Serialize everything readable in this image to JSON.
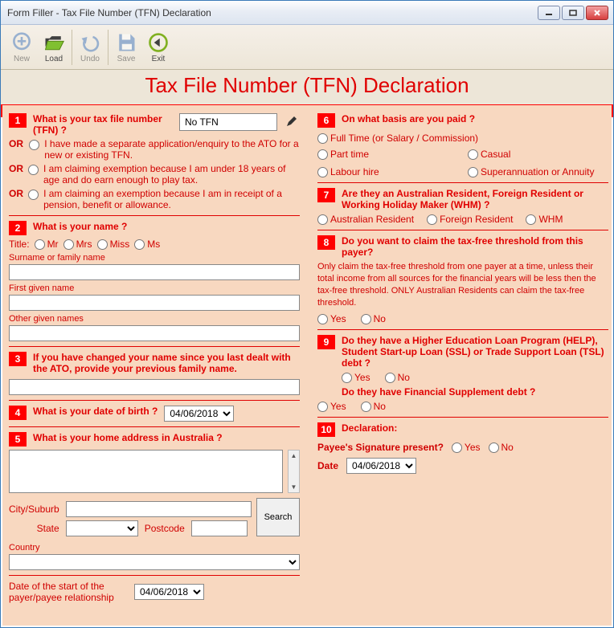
{
  "window": {
    "title": "Form Filler - Tax File Number (TFN) Declaration"
  },
  "toolbar": {
    "new": "New",
    "load": "Load",
    "undo": "Undo",
    "save": "Save",
    "exit": "Exit"
  },
  "header": {
    "title": "Tax File Number (TFN) Declaration"
  },
  "q1": {
    "title": "What is your tax file number (TFN) ?",
    "tfn_value": "No TFN",
    "or": "OR",
    "opt_a": "I have made a separate application/enquiry to the ATO for a new or existing TFN.",
    "opt_b": "I am claiming exemption because I am under 18 years of age and do earn enough to play tax.",
    "opt_c": "I am claiming an exemption because I am in receipt of a pension, benefit or allowance."
  },
  "q2": {
    "title": "What is your name ?",
    "title_label": "Title:",
    "titles": {
      "mr": "Mr",
      "mrs": "Mrs",
      "miss": "Miss",
      "ms": "Ms"
    },
    "surname_label": "Surname or family name",
    "firstname_label": "First given name",
    "othernames_label": "Other given names"
  },
  "q3": {
    "title": "If you have changed your name since you last dealt with the ATO, provide your previous family name."
  },
  "q4": {
    "title": "What is your date of birth ?",
    "date": "04/06/2018"
  },
  "q5": {
    "title": "What is your home address in Australia ?",
    "city_label": "City/Suburb",
    "state_label": "State",
    "postcode_label": "Postcode",
    "country_label": "Country",
    "search": "Search"
  },
  "start_date": {
    "label": "Date of the start of the payer/payee relationship",
    "date": "04/06/2018"
  },
  "q6": {
    "title": "On what basis are you paid ?",
    "opts": {
      "ft": "Full Time (or Salary / Commission)",
      "pt": "Part time",
      "casual": "Casual",
      "labour": "Labour hire",
      "super": "Superannuation or Annuity"
    }
  },
  "q7": {
    "title": "Are they an Australian Resident, Foreign Resident or Working Holiday Maker (WHM) ?",
    "opts": {
      "ar": "Australian Resident",
      "fr": "Foreign Resident",
      "whm": "WHM"
    }
  },
  "q8": {
    "title": "Do you want to claim the tax-free threshold from this payer?",
    "info": "Only claim the tax-free threshold from one payer at a time, unless their total income from all sources for the financial years will be less then the tax-free threshold. ONLY Australian Residents can claim the tax-free threshold.",
    "yes": "Yes",
    "no": "No"
  },
  "q9": {
    "title": "Do they have a Higher Education Loan Program (HELP), Student Start-up Loan (SSL) or Trade Support Loan (TSL) debt ?",
    "sub": "Do they have Financial Supplement debt ?",
    "yes": "Yes",
    "no": "No"
  },
  "q10": {
    "title": "Declaration:",
    "sig_label": "Payee's Signature present?",
    "date_label": "Date",
    "date": "04/06/2018",
    "yes": "Yes",
    "no": "No"
  }
}
